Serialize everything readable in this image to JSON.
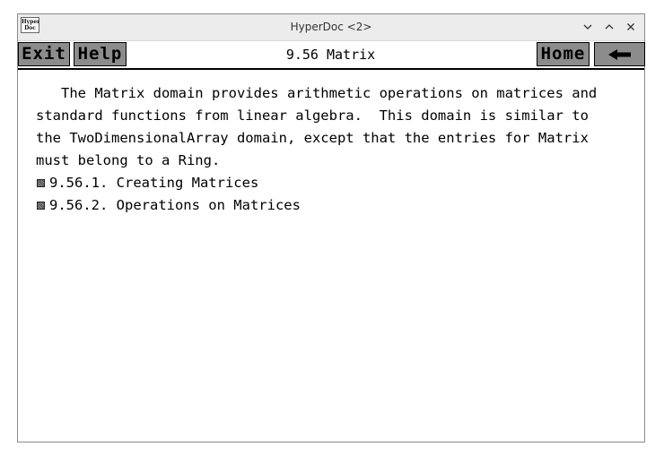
{
  "window": {
    "title": "HyperDoc <2>",
    "icon_text": "Hyper Doc",
    "controls": [
      "chevron-down-icon",
      "chevron-up-icon",
      "close-icon"
    ]
  },
  "toolbar": {
    "exit_label": "Exit",
    "help_label": "Help",
    "page_title": "9.56 Matrix",
    "home_label": "Home",
    "back_icon": "back-arrow-icon"
  },
  "content": {
    "paragraph_lines": [
      "   The Matrix domain provides arithmetic operations on matrices and",
      "standard functions from linear algebra.  This domain is similar to",
      "the TwoDimensionalArray domain, except that the entries for Matrix",
      "must belong to a Ring."
    ],
    "links": [
      "9.56.1. Creating Matrices",
      "9.56.2. Operations on Matrices"
    ]
  }
}
